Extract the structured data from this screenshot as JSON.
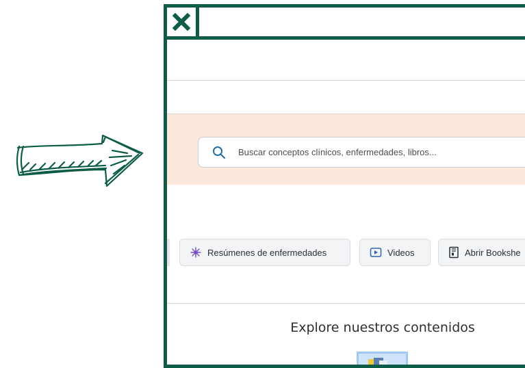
{
  "search": {
    "placeholder": "Buscar conceptos clínicos, enfermedades, libros..."
  },
  "quick_links": [
    {
      "label": "Resúmenes de enfermedades",
      "icon": "sparkle-icon"
    },
    {
      "label": "Videos",
      "icon": "play-icon"
    },
    {
      "label": "Abrir Bookshe",
      "icon": "book-icon"
    }
  ],
  "explore": {
    "title": "Explore nuestros contenidos"
  },
  "colors": {
    "frame": "#0d5c47",
    "search_band": "#fde9dc",
    "search_icon": "#1f6ea8",
    "sparkle_icon": "#7b4fc9"
  }
}
